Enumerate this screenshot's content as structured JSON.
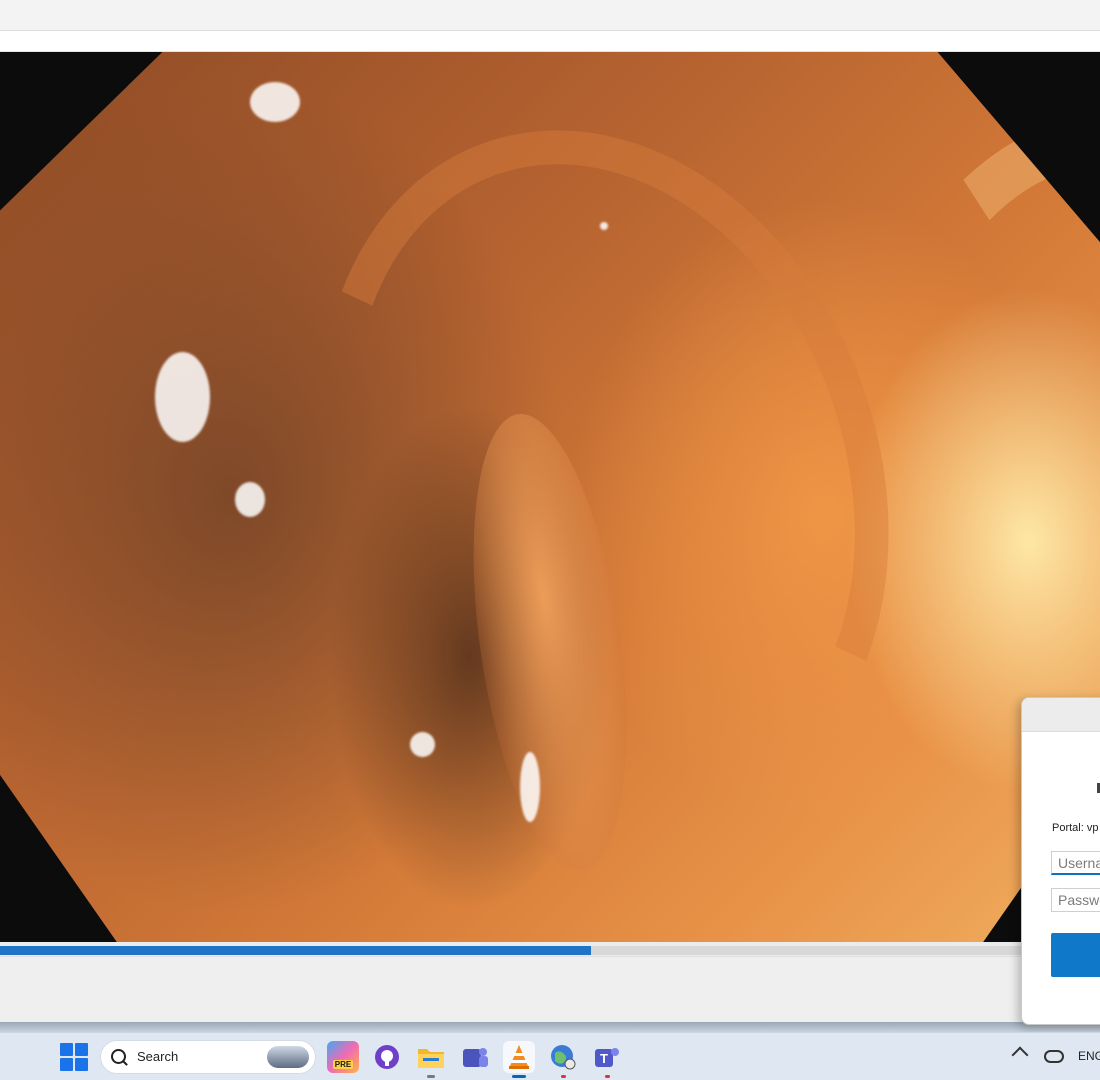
{
  "player": {
    "progress_fraction": 0.537,
    "accent_color": "#1f74c7"
  },
  "vpn_dialog": {
    "portal_label": "Portal: vp",
    "username_placeholder": "Userna",
    "password_placeholder": "Passwo",
    "button_color": "#1078c8"
  },
  "taskbar": {
    "search_label": "Search",
    "apps": [
      {
        "name": "copilot-icon",
        "label": "PRE"
      },
      {
        "name": "github-icon",
        "label": ""
      },
      {
        "name": "file-explorer-icon",
        "label": ""
      },
      {
        "name": "teams-icon",
        "label": "T"
      },
      {
        "name": "vlc-icon",
        "label": ""
      },
      {
        "name": "vpn-globe-icon",
        "label": ""
      },
      {
        "name": "teams-work-icon",
        "label": "T"
      }
    ],
    "tray": {
      "language": "ENG"
    }
  }
}
